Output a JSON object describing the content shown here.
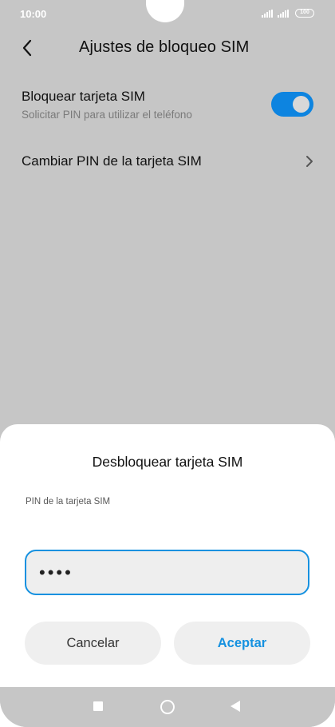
{
  "status_bar": {
    "time": "10:00",
    "battery": "100"
  },
  "header": {
    "title": "Ajustes de bloqueo SIM",
    "back_icon": "back-chevron-icon"
  },
  "settings": {
    "lock_sim": {
      "title": "Bloquear tarjeta SIM",
      "subtitle": "Solicitar PIN para utilizar el teléfono",
      "enabled": true
    },
    "change_pin": {
      "title": "Cambiar PIN de la tarjeta SIM",
      "chevron_icon": "chevron-right-icon"
    }
  },
  "dialog": {
    "title": "Desbloquear tarjeta SIM",
    "field_label": "PIN de la tarjeta SIM",
    "pin_value": "••••",
    "cancel_label": "Cancelar",
    "accept_label": "Aceptar"
  },
  "colors": {
    "accent": "#1591e0",
    "toggle_on": "#0d84e0",
    "background_dim": "#c6c6c6"
  }
}
